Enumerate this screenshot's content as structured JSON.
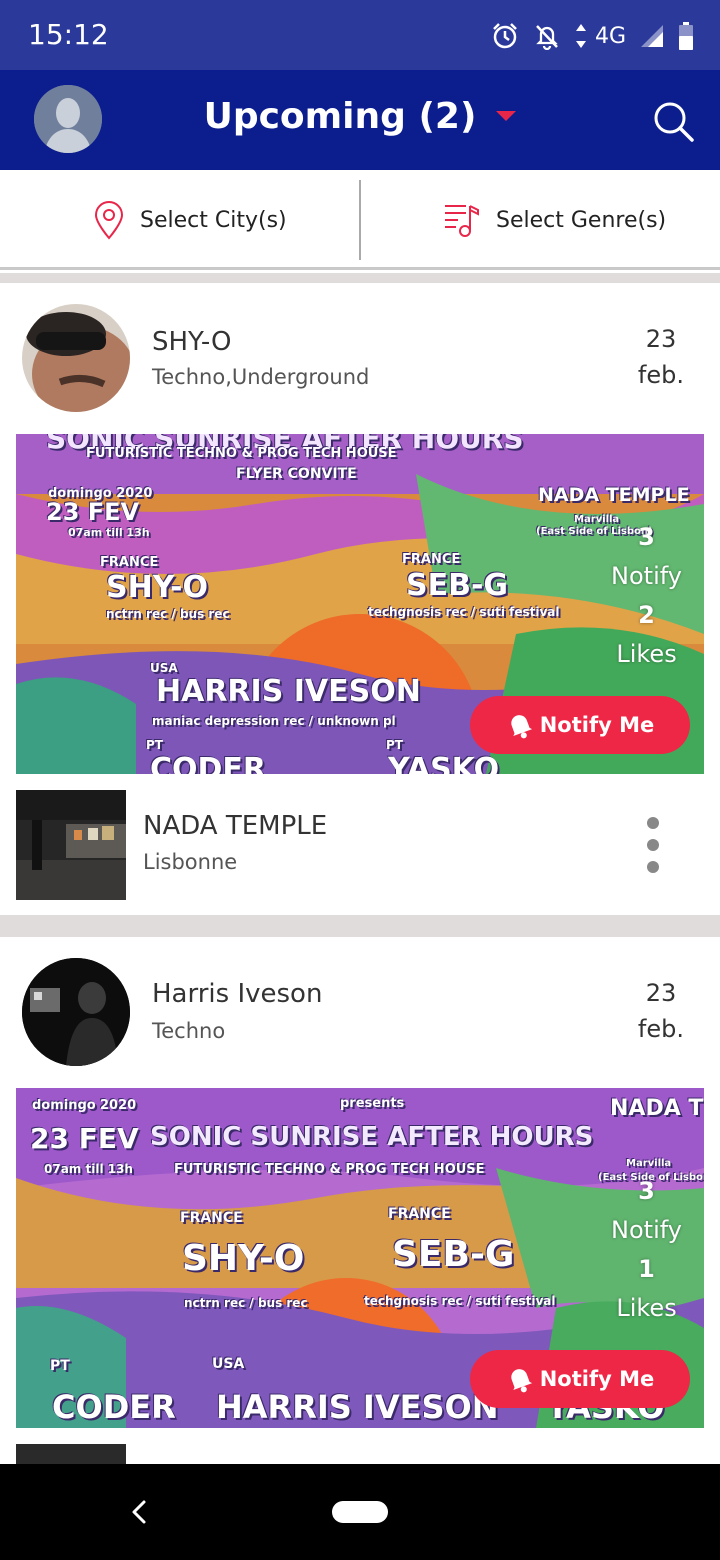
{
  "status_bar": {
    "time": "15:12",
    "network": "4G",
    "icons": [
      "alarm-icon",
      "notifications-off-icon",
      "data-arrows-icon",
      "signal-icon",
      "battery-icon"
    ]
  },
  "app_bar": {
    "title": "Upcoming (2)",
    "accent_color": "#e8264a",
    "icons": [
      "profile-avatar-icon",
      "dropdown-caret-icon",
      "search-icon"
    ]
  },
  "filters": {
    "city_label": "Select City(s)",
    "genre_label": "Select Genre(s)"
  },
  "events": [
    {
      "artist": "SHY-O",
      "genres": "Techno,Underground",
      "date_day": "23",
      "date_month": "feb.",
      "flyer": {
        "line1": "SONIC SUNRISE AFTER HOURS",
        "line2": "FUTURISTIC TECHNO & PROG TECH HOUSE",
        "line3": "FLYER CONVITE",
        "weekday_year": "domingo     2020",
        "date": "23 FEV",
        "hours": "07am till 13h",
        "venue": "NADA TEMPLE",
        "venue_sub": "Marvilla",
        "venue_sub2": "(East Side of Lisbon)",
        "country_a": "FRANCE",
        "artist_a": "SHY-O",
        "label_a": "nctrn rec / bus rec",
        "country_b": "FRANCE",
        "artist_b": "SEB-G",
        "label_b": "techgnosis rec / suti festival",
        "country_c": "USA",
        "artist_c": "HARRIS IVESON",
        "label_c": "maniac depression rec / unknown pl",
        "country_d": "PT",
        "country_e": "PT",
        "artist_d": "CODER",
        "artist_e": "YASKO"
      },
      "notify_count": "3",
      "notify_label": "Notify",
      "likes_count": "2",
      "likes_label": "Likes",
      "notify_button": "Notify Me",
      "venue_name": "NADA TEMPLE",
      "venue_city": "Lisbonne"
    },
    {
      "artist": "Harris Iveson",
      "genres": "Techno",
      "date_day": "23",
      "date_month": "feb.",
      "flyer": {
        "weekday": "domingo",
        "year": "2020",
        "presents": "presents",
        "date": "23 FEV",
        "hours": "07am till 13h",
        "line1": "SONIC SUNRISE AFTER HOURS",
        "line2": "FUTURISTIC TECHNO & PROG TECH HOUSE",
        "venue": "NADA TEMPLE",
        "venue_sub": "Marvilla",
        "venue_sub2": "(East Side of Lisbon)",
        "country_a": "FRANCE",
        "artist_a": "SHY-O",
        "label_a": "nctrn rec / bus rec",
        "country_b": "FRANCE",
        "artist_b": "SEB-G",
        "label_b": "techgnosis rec / suti festival",
        "country_c": "PT",
        "country_d": "USA",
        "artist_c": "CODER",
        "artist_d": "HARRIS IVESON",
        "artist_e": "YASKO"
      },
      "notify_count": "3",
      "notify_label": "Notify",
      "likes_count": "1",
      "likes_label": "Likes",
      "notify_button": "Notify Me"
    }
  ],
  "nav_bar": {
    "icons": [
      "back-icon",
      "home-pill-icon"
    ]
  }
}
